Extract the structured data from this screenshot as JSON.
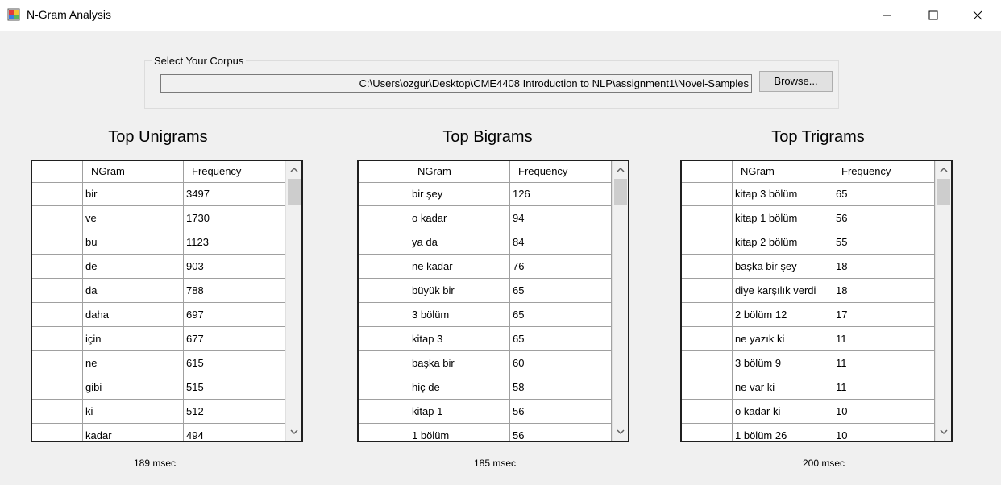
{
  "window": {
    "title": "N-Gram Analysis"
  },
  "corpus": {
    "group_label": "Select Your Corpus",
    "path": "C:\\Users\\ozgur\\Desktop\\CME4408  Introduction to NLP\\assignment1\\Novel-Samples",
    "browse_label": "Browse..."
  },
  "panels": [
    {
      "title": "Top Unigrams",
      "columns": [
        "NGram",
        "Frequency"
      ],
      "timing": "189 msec",
      "rows": [
        {
          "ngram": "bir",
          "freq": "3497"
        },
        {
          "ngram": "ve",
          "freq": "1730"
        },
        {
          "ngram": "bu",
          "freq": "1123"
        },
        {
          "ngram": "de",
          "freq": "903"
        },
        {
          "ngram": "da",
          "freq": "788"
        },
        {
          "ngram": "daha",
          "freq": "697"
        },
        {
          "ngram": "için",
          "freq": "677"
        },
        {
          "ngram": "ne",
          "freq": "615"
        },
        {
          "ngram": "gibi",
          "freq": "515"
        },
        {
          "ngram": "ki",
          "freq": "512"
        },
        {
          "ngram": "kadar",
          "freq": "494"
        }
      ]
    },
    {
      "title": "Top Bigrams",
      "columns": [
        "NGram",
        "Frequency"
      ],
      "timing": "185 msec",
      "rows": [
        {
          "ngram": "bir şey",
          "freq": "126"
        },
        {
          "ngram": "o kadar",
          "freq": "94"
        },
        {
          "ngram": "ya da",
          "freq": "84"
        },
        {
          "ngram": "ne kadar",
          "freq": "76"
        },
        {
          "ngram": "büyük bir",
          "freq": "65"
        },
        {
          "ngram": "3 bölüm",
          "freq": "65"
        },
        {
          "ngram": "kitap 3",
          "freq": "65"
        },
        {
          "ngram": "başka bir",
          "freq": "60"
        },
        {
          "ngram": "hiç de",
          "freq": "58"
        },
        {
          "ngram": "kitap 1",
          "freq": "56"
        },
        {
          "ngram": "1 bölüm",
          "freq": "56"
        }
      ]
    },
    {
      "title": "Top Trigrams",
      "columns": [
        "NGram",
        "Frequency"
      ],
      "timing": "200 msec",
      "rows": [
        {
          "ngram": "kitap 3 bölüm",
          "freq": "65"
        },
        {
          "ngram": "kitap 1 bölüm",
          "freq": "56"
        },
        {
          "ngram": "kitap 2 bölüm",
          "freq": "55"
        },
        {
          "ngram": "başka bir şey",
          "freq": "18"
        },
        {
          "ngram": "diye karşılık verdi",
          "freq": "18"
        },
        {
          "ngram": "2 bölüm 12",
          "freq": "17"
        },
        {
          "ngram": "ne yazık ki",
          "freq": "11"
        },
        {
          "ngram": "3 bölüm 9",
          "freq": "11"
        },
        {
          "ngram": "ne var ki",
          "freq": "11"
        },
        {
          "ngram": "o kadar ki",
          "freq": "10"
        },
        {
          "ngram": "1 bölüm 26",
          "freq": "10"
        }
      ]
    }
  ]
}
